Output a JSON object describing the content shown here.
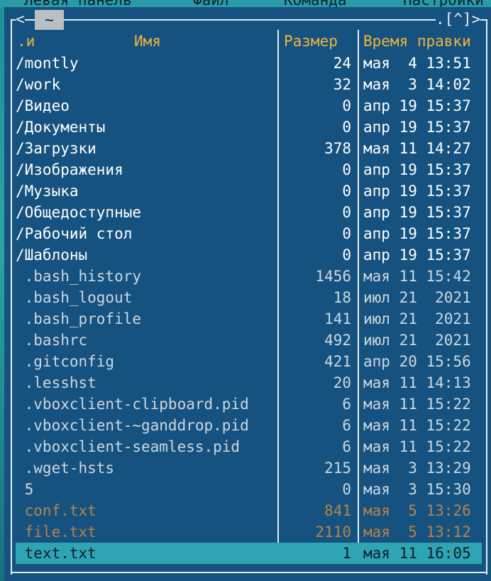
{
  "menu": [
    "Левая панель",
    "Файл",
    "Команда",
    "Настройки"
  ],
  "panel": {
    "corner_left": "<",
    "path_label": "~",
    "corner_right": ".[^]>",
    "columns": {
      "name_sort": ".и",
      "name": "Имя",
      "size": "Размер",
      "mtime": "Время правки"
    }
  },
  "files": [
    {
      "name": "/montly",
      "size": "24",
      "mtime": "мая  4 13:51",
      "kind": "dir"
    },
    {
      "name": "/work",
      "size": "32",
      "mtime": "мая  3 14:02",
      "kind": "dir"
    },
    {
      "name": "/Видео",
      "size": "0",
      "mtime": "апр 19 15:37",
      "kind": "dir"
    },
    {
      "name": "/Документы",
      "size": "0",
      "mtime": "апр 19 15:37",
      "kind": "dir"
    },
    {
      "name": "/Загрузки",
      "size": "378",
      "mtime": "мая 11 14:27",
      "kind": "dir"
    },
    {
      "name": "/Изображения",
      "size": "0",
      "mtime": "апр 19 15:37",
      "kind": "dir"
    },
    {
      "name": "/Музыка",
      "size": "0",
      "mtime": "апр 19 15:37",
      "kind": "dir"
    },
    {
      "name": "/Общедоступные",
      "size": "0",
      "mtime": "апр 19 15:37",
      "kind": "dir"
    },
    {
      "name": "/Рабочий стол",
      "size": "0",
      "mtime": "апр 19 15:37",
      "kind": "dir"
    },
    {
      "name": "/Шаблоны",
      "size": "0",
      "mtime": "апр 19 15:37",
      "kind": "dir"
    },
    {
      "name": " .bash_history",
      "size": "1456",
      "mtime": "мая 11 15:42",
      "kind": "file"
    },
    {
      "name": " .bash_logout",
      "size": "18",
      "mtime": "июл 21  2021",
      "kind": "file"
    },
    {
      "name": " .bash_profile",
      "size": "141",
      "mtime": "июл 21  2021",
      "kind": "file"
    },
    {
      "name": " .bashrc",
      "size": "492",
      "mtime": "июл 21  2021",
      "kind": "file"
    },
    {
      "name": " .gitconfig",
      "size": "421",
      "mtime": "апр 20 15:56",
      "kind": "file"
    },
    {
      "name": " .lesshst",
      "size": "20",
      "mtime": "мая 11 14:13",
      "kind": "file"
    },
    {
      "name": " .vboxclient-clipboard.pid",
      "size": "6",
      "mtime": "мая 11 15:22",
      "kind": "file"
    },
    {
      "name": " .vboxclient-~ganddrop.pid",
      "size": "6",
      "mtime": "мая 11 15:22",
      "kind": "file"
    },
    {
      "name": " .vboxclient-seamless.pid",
      "size": "6",
      "mtime": "мая 11 15:22",
      "kind": "file"
    },
    {
      "name": " .wget-hsts",
      "size": "215",
      "mtime": "мая  3 13:29",
      "kind": "file"
    },
    {
      "name": " 5",
      "size": "0",
      "mtime": "мая  3 15:30",
      "kind": "file"
    },
    {
      "name": " conf.txt",
      "size": "841",
      "mtime": "мая  5 13:26",
      "kind": "txt"
    },
    {
      "name": " file.txt",
      "size": "2110",
      "mtime": "мая  5 13:12",
      "kind": "txt"
    },
    {
      "name": " text.txt",
      "size": "1",
      "mtime": "мая 11 16:05",
      "kind": "selected"
    }
  ],
  "colors": {
    "panel_bg": "#15527f",
    "directory": "#ffffff",
    "file": "#cdd8df",
    "text_file": "#b98349",
    "header": "#f0b43c",
    "selection": "#2fa5b4"
  }
}
